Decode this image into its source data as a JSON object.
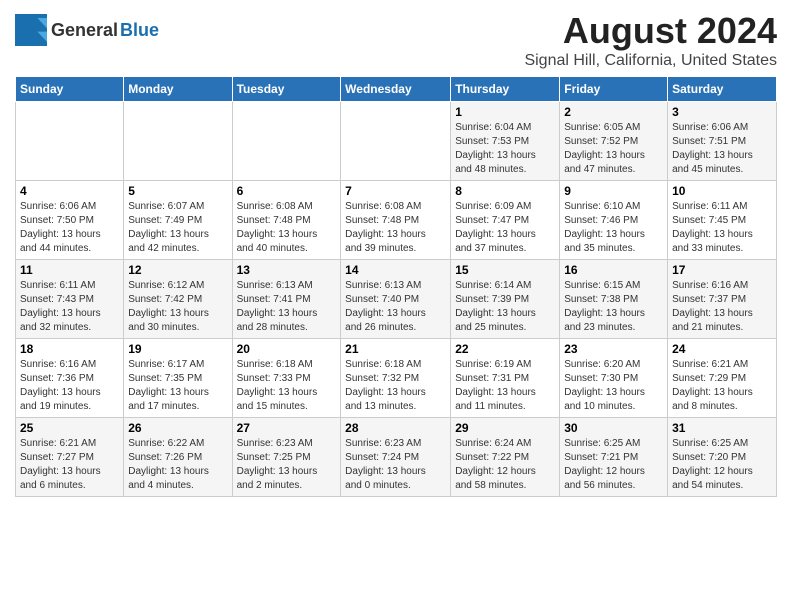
{
  "header": {
    "logo_line1": "General",
    "logo_line2": "Blue",
    "title": "August 2024",
    "subtitle": "Signal Hill, California, United States"
  },
  "weekdays": [
    "Sunday",
    "Monday",
    "Tuesday",
    "Wednesday",
    "Thursday",
    "Friday",
    "Saturday"
  ],
  "weeks": [
    [
      {
        "day": "",
        "info": ""
      },
      {
        "day": "",
        "info": ""
      },
      {
        "day": "",
        "info": ""
      },
      {
        "day": "",
        "info": ""
      },
      {
        "day": "1",
        "info": "Sunrise: 6:04 AM\nSunset: 7:53 PM\nDaylight: 13 hours\nand 48 minutes."
      },
      {
        "day": "2",
        "info": "Sunrise: 6:05 AM\nSunset: 7:52 PM\nDaylight: 13 hours\nand 47 minutes."
      },
      {
        "day": "3",
        "info": "Sunrise: 6:06 AM\nSunset: 7:51 PM\nDaylight: 13 hours\nand 45 minutes."
      }
    ],
    [
      {
        "day": "4",
        "info": "Sunrise: 6:06 AM\nSunset: 7:50 PM\nDaylight: 13 hours\nand 44 minutes."
      },
      {
        "day": "5",
        "info": "Sunrise: 6:07 AM\nSunset: 7:49 PM\nDaylight: 13 hours\nand 42 minutes."
      },
      {
        "day": "6",
        "info": "Sunrise: 6:08 AM\nSunset: 7:48 PM\nDaylight: 13 hours\nand 40 minutes."
      },
      {
        "day": "7",
        "info": "Sunrise: 6:08 AM\nSunset: 7:48 PM\nDaylight: 13 hours\nand 39 minutes."
      },
      {
        "day": "8",
        "info": "Sunrise: 6:09 AM\nSunset: 7:47 PM\nDaylight: 13 hours\nand 37 minutes."
      },
      {
        "day": "9",
        "info": "Sunrise: 6:10 AM\nSunset: 7:46 PM\nDaylight: 13 hours\nand 35 minutes."
      },
      {
        "day": "10",
        "info": "Sunrise: 6:11 AM\nSunset: 7:45 PM\nDaylight: 13 hours\nand 33 minutes."
      }
    ],
    [
      {
        "day": "11",
        "info": "Sunrise: 6:11 AM\nSunset: 7:43 PM\nDaylight: 13 hours\nand 32 minutes."
      },
      {
        "day": "12",
        "info": "Sunrise: 6:12 AM\nSunset: 7:42 PM\nDaylight: 13 hours\nand 30 minutes."
      },
      {
        "day": "13",
        "info": "Sunrise: 6:13 AM\nSunset: 7:41 PM\nDaylight: 13 hours\nand 28 minutes."
      },
      {
        "day": "14",
        "info": "Sunrise: 6:13 AM\nSunset: 7:40 PM\nDaylight: 13 hours\nand 26 minutes."
      },
      {
        "day": "15",
        "info": "Sunrise: 6:14 AM\nSunset: 7:39 PM\nDaylight: 13 hours\nand 25 minutes."
      },
      {
        "day": "16",
        "info": "Sunrise: 6:15 AM\nSunset: 7:38 PM\nDaylight: 13 hours\nand 23 minutes."
      },
      {
        "day": "17",
        "info": "Sunrise: 6:16 AM\nSunset: 7:37 PM\nDaylight: 13 hours\nand 21 minutes."
      }
    ],
    [
      {
        "day": "18",
        "info": "Sunrise: 6:16 AM\nSunset: 7:36 PM\nDaylight: 13 hours\nand 19 minutes."
      },
      {
        "day": "19",
        "info": "Sunrise: 6:17 AM\nSunset: 7:35 PM\nDaylight: 13 hours\nand 17 minutes."
      },
      {
        "day": "20",
        "info": "Sunrise: 6:18 AM\nSunset: 7:33 PM\nDaylight: 13 hours\nand 15 minutes."
      },
      {
        "day": "21",
        "info": "Sunrise: 6:18 AM\nSunset: 7:32 PM\nDaylight: 13 hours\nand 13 minutes."
      },
      {
        "day": "22",
        "info": "Sunrise: 6:19 AM\nSunset: 7:31 PM\nDaylight: 13 hours\nand 11 minutes."
      },
      {
        "day": "23",
        "info": "Sunrise: 6:20 AM\nSunset: 7:30 PM\nDaylight: 13 hours\nand 10 minutes."
      },
      {
        "day": "24",
        "info": "Sunrise: 6:21 AM\nSunset: 7:29 PM\nDaylight: 13 hours\nand 8 minutes."
      }
    ],
    [
      {
        "day": "25",
        "info": "Sunrise: 6:21 AM\nSunset: 7:27 PM\nDaylight: 13 hours\nand 6 minutes."
      },
      {
        "day": "26",
        "info": "Sunrise: 6:22 AM\nSunset: 7:26 PM\nDaylight: 13 hours\nand 4 minutes."
      },
      {
        "day": "27",
        "info": "Sunrise: 6:23 AM\nSunset: 7:25 PM\nDaylight: 13 hours\nand 2 minutes."
      },
      {
        "day": "28",
        "info": "Sunrise: 6:23 AM\nSunset: 7:24 PM\nDaylight: 13 hours\nand 0 minutes."
      },
      {
        "day": "29",
        "info": "Sunrise: 6:24 AM\nSunset: 7:22 PM\nDaylight: 12 hours\nand 58 minutes."
      },
      {
        "day": "30",
        "info": "Sunrise: 6:25 AM\nSunset: 7:21 PM\nDaylight: 12 hours\nand 56 minutes."
      },
      {
        "day": "31",
        "info": "Sunrise: 6:25 AM\nSunset: 7:20 PM\nDaylight: 12 hours\nand 54 minutes."
      }
    ]
  ]
}
